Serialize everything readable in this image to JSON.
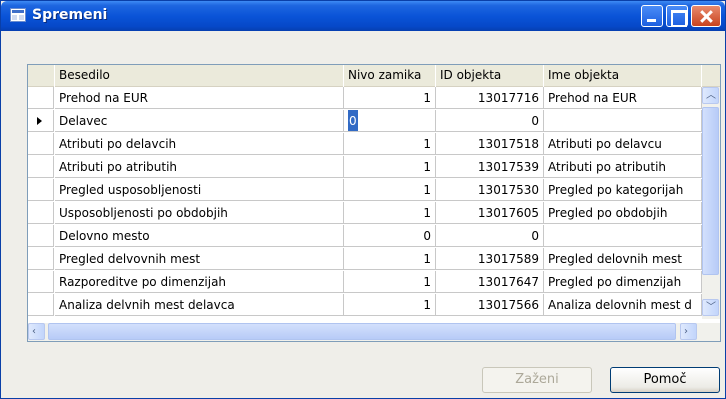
{
  "window": {
    "title": "Spremeni"
  },
  "grid": {
    "columns": [
      "Besedilo",
      "Nivo zamika",
      "ID objekta",
      "Ime objekta"
    ],
    "rows": [
      {
        "text": "Prehod na EUR",
        "level": "1",
        "id": "13017716",
        "name": "Prehod na EUR"
      },
      {
        "text": "Delavec",
        "level": "0",
        "id": "0",
        "name": ""
      },
      {
        "text": "Atributi po delavcih",
        "level": "1",
        "id": "13017518",
        "name": "Atributi po delavcu"
      },
      {
        "text": "Atributi po atributih",
        "level": "1",
        "id": "13017539",
        "name": "Atributi po atributih"
      },
      {
        "text": "Pregled usposobljenosti",
        "level": "1",
        "id": "13017530",
        "name": "Pregled po kategorijah"
      },
      {
        "text": "Usposobljenosti po obdobjih",
        "level": "1",
        "id": "13017605",
        "name": "Pregled po obdobjih"
      },
      {
        "text": "Delovno mesto",
        "level": "0",
        "id": "0",
        "name": ""
      },
      {
        "text": "Pregled delvovnih mest",
        "level": "1",
        "id": "13017589",
        "name": "Pregled delovnih mest"
      },
      {
        "text": "Razporeditve po dimenzijah",
        "level": "1",
        "id": "13017647",
        "name": "Pregled po dimenzijah"
      },
      {
        "text": "Analiza delvnih mest delavca",
        "level": "1",
        "id": "13017566",
        "name": "Analiza delovnih mest d"
      }
    ]
  },
  "buttons": {
    "run": "Zaženi",
    "help": "Pomoč"
  }
}
